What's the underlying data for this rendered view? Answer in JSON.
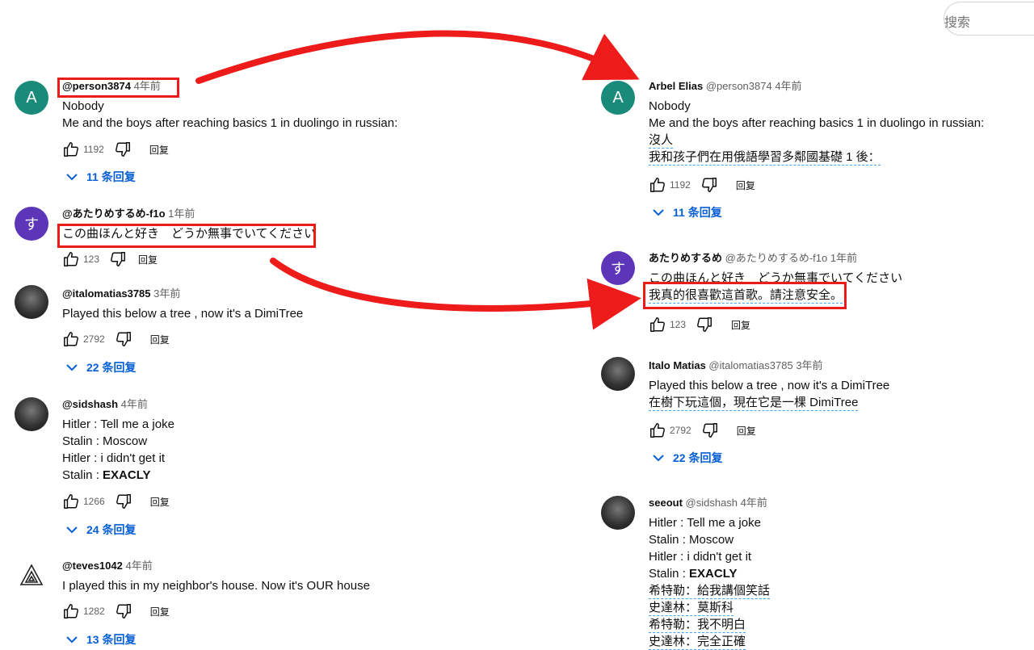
{
  "search": {
    "placeholder": "搜索"
  },
  "left": {
    "comments": [
      {
        "handle": "@person3874",
        "time": "4年前",
        "lines": [
          "Nobody",
          "Me and the boys after reaching basics 1 in duolingo in russian:"
        ],
        "likes": "1192",
        "reply": "回复",
        "replies": "11 条回复",
        "avatar": "A"
      },
      {
        "handle": "@あたりめするめ-f1o",
        "time": "1年前",
        "lines": [
          "この曲ほんと好き　どうか無事でいてください"
        ],
        "likes": "123",
        "reply": "回复",
        "avatar": "す"
      },
      {
        "handle": "@italomatias3785",
        "time": "3年前",
        "lines": [
          "Played this below a tree , now it's a DimiTree"
        ],
        "likes": "2792",
        "reply": "回复",
        "replies": "22 条回复"
      },
      {
        "handle": "@sidshash",
        "time": "4年前",
        "lines": [
          "Hitler : Tell me a joke",
          "Stalin : Moscow",
          "Hitler : i didn't get it",
          "Stalin : ",
          "EXACLY"
        ],
        "likes": "1266",
        "reply": "回复",
        "replies": "24 条回复"
      },
      {
        "handle": "@teves1042",
        "time": "4年前",
        "lines": [
          "I played this in my neighbor's house. Now it's OUR house"
        ],
        "likes": "1282",
        "reply": "回复",
        "replies": "13 条回复"
      }
    ]
  },
  "right": {
    "comments": [
      {
        "name": "Arbel Elias",
        "handle": "@person3874",
        "time": "4年前",
        "lines": [
          "Nobody",
          "Me and the boys after reaching basics 1 in duolingo in russian:"
        ],
        "translated": [
          "沒人",
          "我和孩子們在用俄語學習多鄰國基礎 1 後："
        ],
        "likes": "1192",
        "reply": "回复",
        "replies": "11 条回复",
        "avatar": "A"
      },
      {
        "name": "あたりめするめ",
        "handle": "@あたりめするめ-f1o",
        "time": "1年前",
        "lines": [
          "この曲ほんと好き　どうか無事でいてください"
        ],
        "translated": [
          "我真的很喜歡這首歌。請注意安全。"
        ],
        "likes": "123",
        "reply": "回复",
        "avatar": "す"
      },
      {
        "name": "Italo Matias",
        "handle": "@italomatias3785",
        "time": "3年前",
        "lines": [
          "Played this below a tree , now it's a DimiTree"
        ],
        "translated": [
          "在樹下玩這個，現在它是一棵 DimiTree"
        ],
        "likes": "2792",
        "reply": "回复",
        "replies": "22 条回复"
      },
      {
        "name": "seeout",
        "handle": "@sidshash",
        "time": "4年前",
        "lines": [
          "Hitler : Tell me a joke",
          "Stalin : Moscow",
          "Hitler : i didn't get it",
          "Stalin : ",
          "EXACLY"
        ],
        "translated": [
          "希特勒：給我講個笑話",
          "史達林：莫斯科",
          "希特勒：我不明白",
          "史達林：完全正確"
        ]
      }
    ]
  },
  "colors": {
    "highlight": "#ee1b1b",
    "link": "#065fd4",
    "translation_underline": "#3ea6ff"
  }
}
